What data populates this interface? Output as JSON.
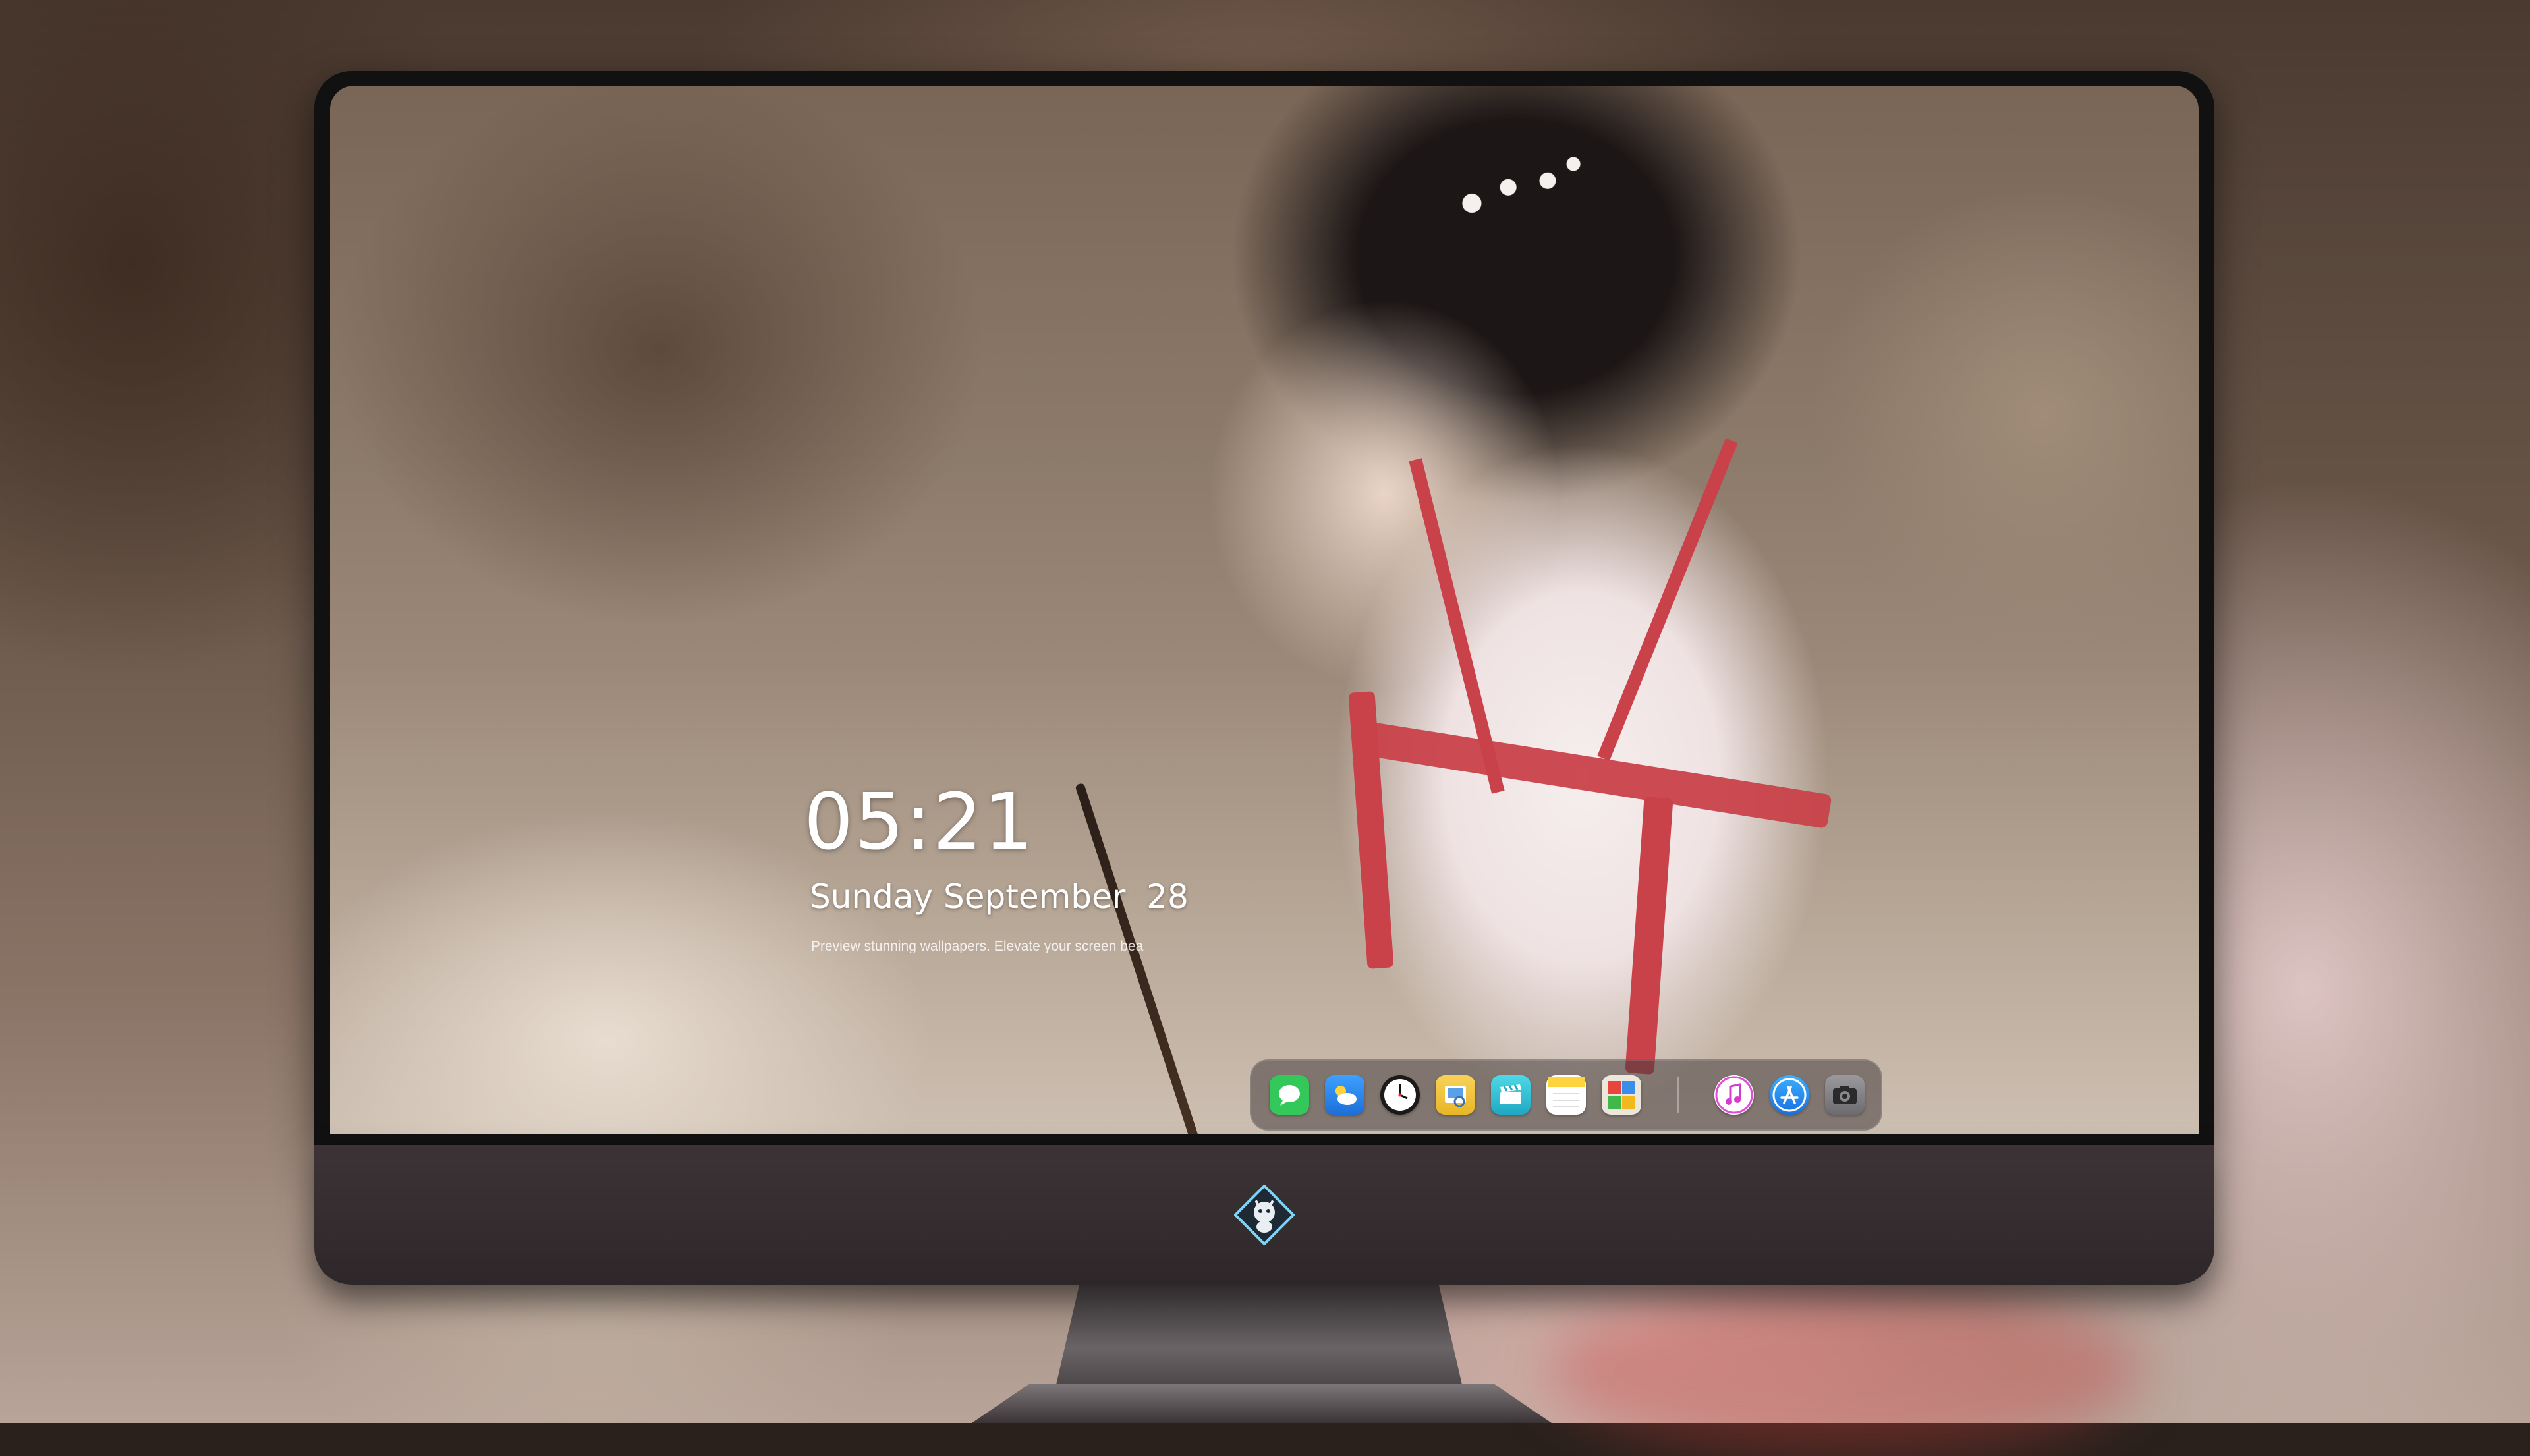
{
  "lockscreen": {
    "time": "05:21",
    "date": "Sunday September  28",
    "tagline": "Preview stunning wallpapers. Elevate your screen bea"
  },
  "dock": {
    "apps": [
      {
        "name": "Messages",
        "icon": "messages-icon",
        "color": "#34c759"
      },
      {
        "name": "Weather",
        "icon": "weather-icon",
        "color": "#2f8ff0"
      },
      {
        "name": "Clock",
        "icon": "clock-icon",
        "color": "#ffffff"
      },
      {
        "name": "Preview",
        "icon": "preview-icon",
        "color": "#f5c542"
      },
      {
        "name": "Clips",
        "icon": "clips-icon",
        "color": "#3cc7d6"
      },
      {
        "name": "Notes",
        "icon": "notes-icon",
        "color": "#ffd33d"
      },
      {
        "name": "Photo Booth",
        "icon": "photobooth-icon",
        "color": "#e8e2da"
      },
      {
        "name": "iTunes",
        "icon": "music-icon",
        "color": "#e24dd7"
      },
      {
        "name": "App Store",
        "icon": "appstore-icon",
        "color": "#1f8cf0"
      },
      {
        "name": "Camera",
        "icon": "camera-icon",
        "color": "#8a8a8e"
      }
    ]
  },
  "monitor": {
    "logo": "dragon-logo-icon"
  }
}
